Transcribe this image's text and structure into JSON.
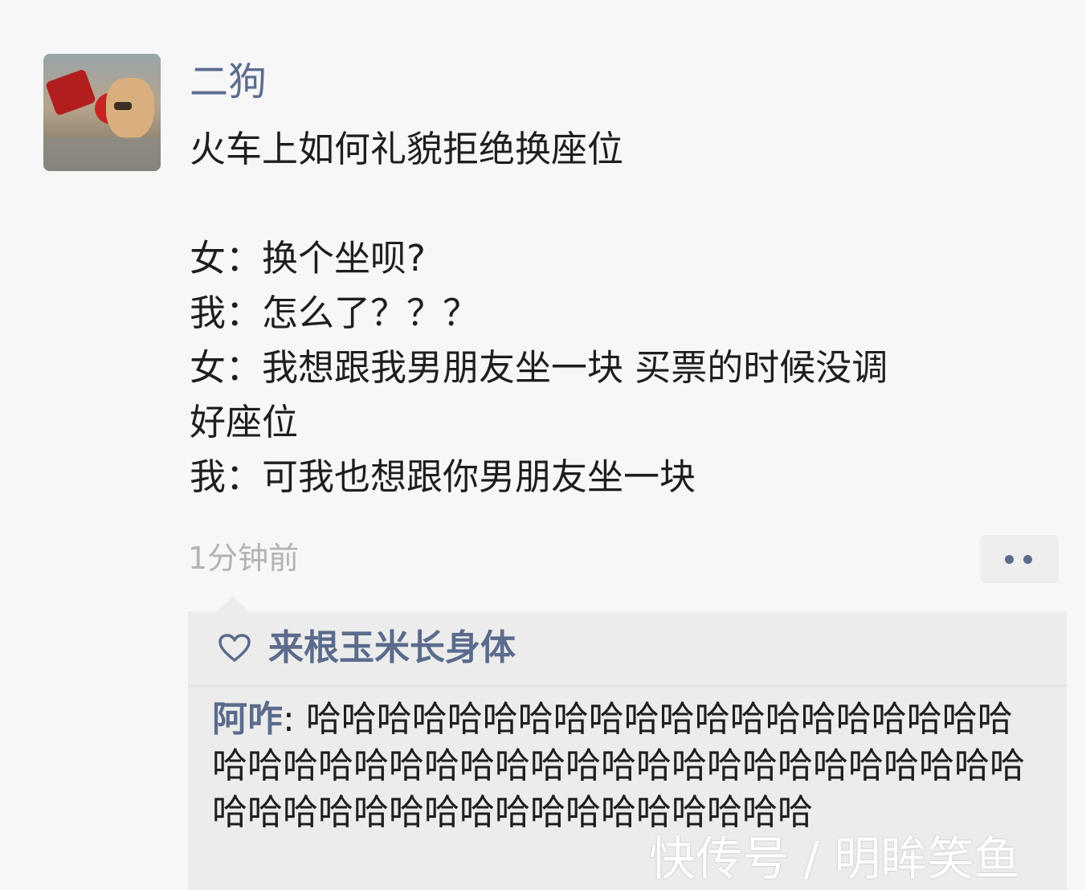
{
  "post": {
    "username": "二狗",
    "lines": [
      "火车上如何礼貌拒绝换座位",
      "",
      "女：换个坐呗?",
      "我：怎么了？？？",
      "女：我想跟我男朋友坐一块 买票的时候没调",
      "好座位",
      "我：可我也想跟你男朋友坐一块"
    ],
    "time": "1分钟前",
    "more_icon": "more-dots-icon"
  },
  "comments": {
    "like_icon": "heart-outline-icon",
    "likes": "来根玉米长身体",
    "items": [
      {
        "name": "阿咋",
        "sep": ": ",
        "text": "哈哈哈哈哈哈哈哈哈哈哈哈哈哈哈哈哈哈哈哈哈哈哈哈哈哈哈哈哈哈哈哈哈哈哈哈哈哈哈哈哈哈哈哈哈哈哈哈哈哈哈哈哈哈哈哈哈哈哈哈"
      }
    ]
  },
  "watermark": "快传号 / 明眸笑鱼",
  "colors": {
    "name_blue": "#5b6b8c",
    "time_gray": "#b3b3b3",
    "background": "#f7f7f7",
    "comment_bg": "#ececec"
  }
}
